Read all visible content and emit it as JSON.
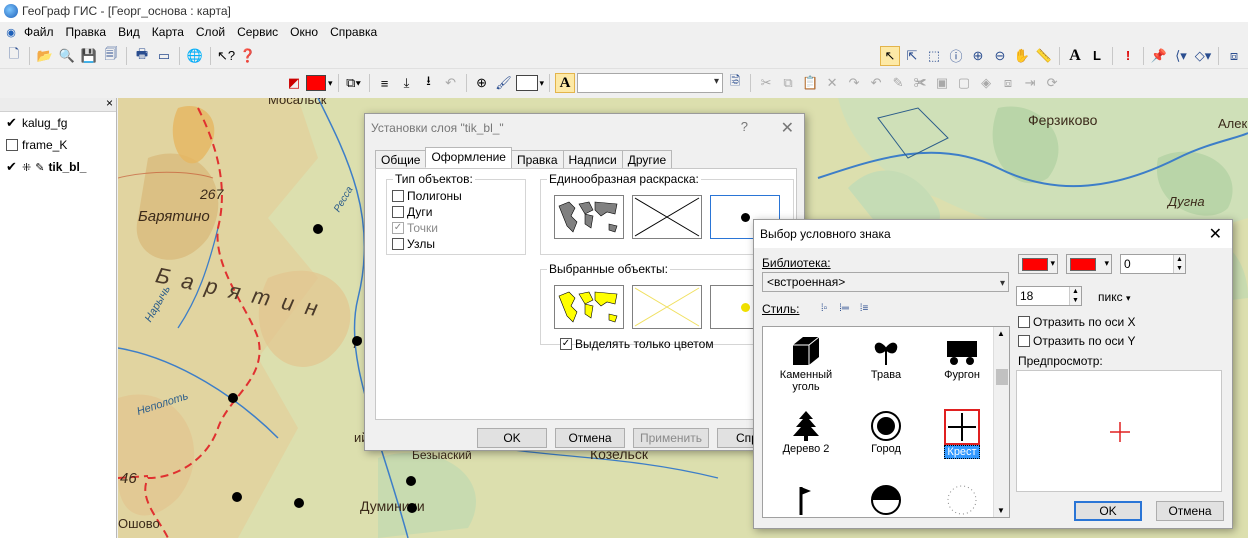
{
  "window": {
    "title": "ГеоГраф ГИС - [Георг_основа : карта]"
  },
  "menu": [
    "Файл",
    "Правка",
    "Вид",
    "Карта",
    "Слой",
    "Сервис",
    "Окно",
    "Справка"
  ],
  "layers": [
    {
      "name": "kalug_fg",
      "checked": true
    },
    {
      "name": "frame_K",
      "checked": false
    },
    {
      "name": "tik_bl_",
      "checked": true
    }
  ],
  "map_labels": {
    "l1": "267",
    "l2": "Барятино",
    "l3": "Барятин",
    "l4": "Неполоть",
    "l5": "Мосальск",
    "l6": "46",
    "l7": "Думиничи",
    "l8": "Козельск",
    "l9": "Ферзиково",
    "l10": "Дугна",
    "l11": "Алек",
    "l12": "Ошово",
    "l13": "ий",
    "l14": "Безыаский",
    "l15": "Ресса",
    "l16": "р",
    "l17": "Нарычь"
  },
  "layer_dialog": {
    "title": "Установки слоя \"tik_bl_\"",
    "help": "?",
    "tabs": [
      "Общие",
      "Оформление",
      "Правка",
      "Надписи",
      "Другие"
    ],
    "active_tab": "Оформление",
    "obj_types_label": "Тип объектов:",
    "obj_types": [
      {
        "label": "Полигоны",
        "checked": false,
        "disabled": false
      },
      {
        "label": "Дуги",
        "checked": false,
        "disabled": false
      },
      {
        "label": "Точки",
        "checked": true,
        "disabled": true
      },
      {
        "label": "Узлы",
        "checked": false,
        "disabled": false
      }
    ],
    "uniform_label": "Единообразная раскраска:",
    "selected_label": "Выбранные объекты:",
    "color_only_label": "Выделять только цветом",
    "color_only_checked": true,
    "buttons": {
      "ok": "OK",
      "cancel": "Отмена",
      "apply": "Применить",
      "help": "Спр"
    }
  },
  "symbol_dialog": {
    "title": "Выбор условного знака",
    "library_label": "Библиотека:",
    "library_value": "<встроенная>",
    "style_label": "Стиль:",
    "symbols": [
      {
        "name": "Каменный уголь",
        "glyph": "cube"
      },
      {
        "name": "Трава",
        "glyph": "grass"
      },
      {
        "name": "Фургон",
        "glyph": "wagon"
      },
      {
        "name": "Дерево 2",
        "glyph": "tree"
      },
      {
        "name": "Город",
        "glyph": "city"
      },
      {
        "name": "Крест",
        "glyph": "cross",
        "selected": true
      },
      {
        "name": "",
        "glyph": "flag"
      },
      {
        "name": "",
        "glyph": "half-circle"
      },
      {
        "name": "",
        "glyph": "dotted-circle"
      }
    ],
    "angle_value": "0",
    "size_value": "18",
    "unit_label": "пикс",
    "mirror_x_label": "Отразить по оси X",
    "mirror_y_label": "Отразить по оси Y",
    "preview_label": "Предпросмотр:",
    "buttons": {
      "ok": "OK",
      "cancel": "Отмена"
    },
    "color1": "#ff0000",
    "color2": "#ff0000"
  }
}
